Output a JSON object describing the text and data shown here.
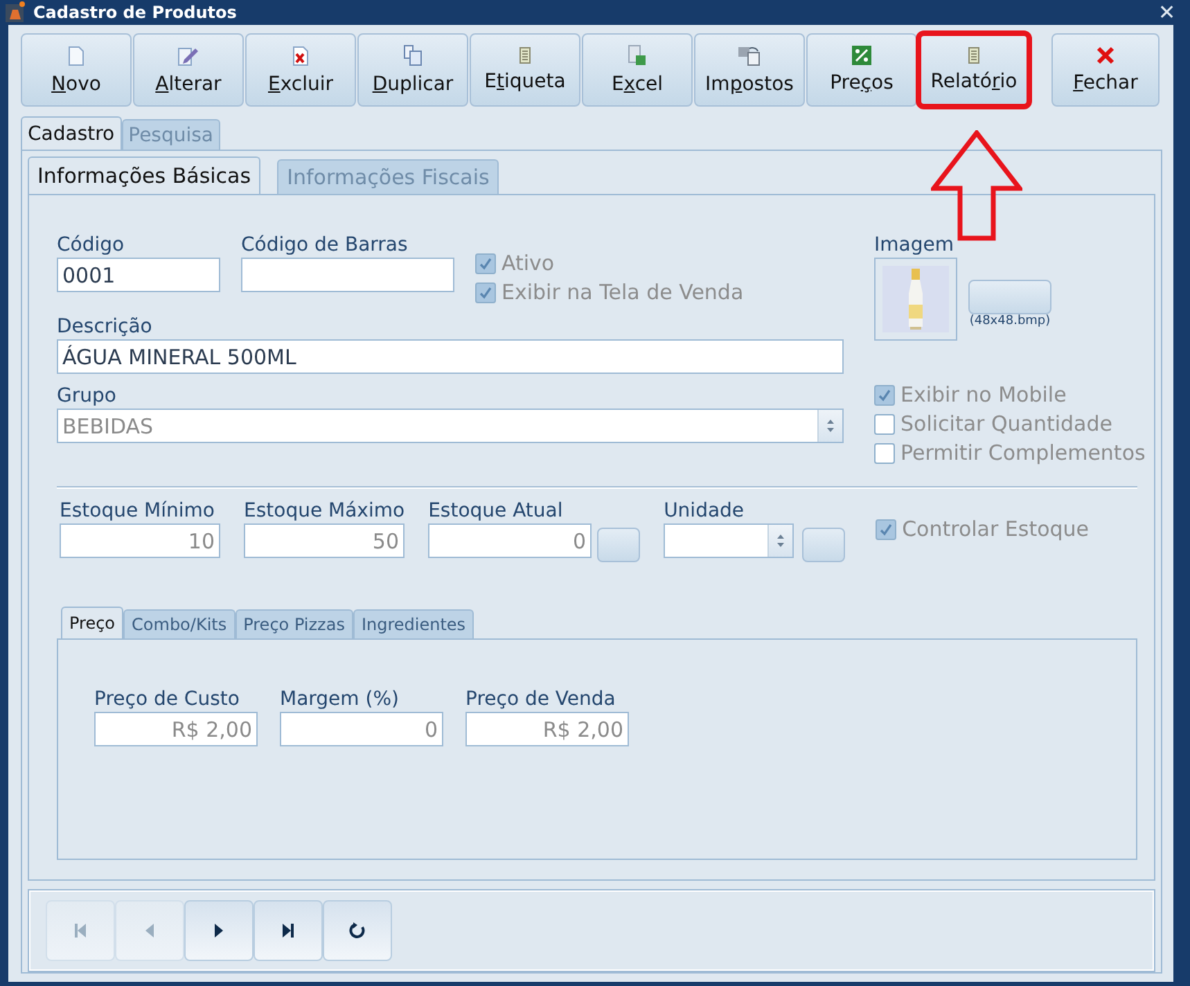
{
  "window": {
    "title": "Cadastro de Produtos",
    "close": "✕"
  },
  "toolbar": [
    {
      "key": "N",
      "post": "ovo",
      "highlighted": false
    },
    {
      "key": "A",
      "post": "lterar",
      "highlighted": false
    },
    {
      "key": "E",
      "post": "xcluir",
      "highlighted": false
    },
    {
      "key": "D",
      "post": "uplicar",
      "highlighted": false
    },
    {
      "pre": "E",
      "key": "t",
      "post": "iqueta",
      "highlighted": false
    },
    {
      "pre": "E",
      "key": "x",
      "post": "cel",
      "highlighted": false
    },
    {
      "pre": "Im",
      "key": "p",
      "post": "ostos",
      "highlighted": false
    },
    {
      "pre": "Pre",
      "key": "ç",
      "post": "os",
      "highlighted": false
    },
    {
      "pre": "Relató",
      "key": "r",
      "post": "io",
      "highlighted": true
    },
    {
      "key": "F",
      "post": "echar",
      "highlighted": false
    }
  ],
  "tabs": [
    {
      "label": "Cadastro",
      "selected": true
    },
    {
      "label": "Pesquisa",
      "selected": false
    }
  ],
  "subtabs": [
    {
      "label": "Informações Básicas",
      "selected": true
    },
    {
      "label": "Informações Fiscais",
      "selected": false
    }
  ],
  "form": {
    "codigo": {
      "label": "Código",
      "value": "0001"
    },
    "barras": {
      "label": "Código de Barras"
    },
    "flags": [
      {
        "label": "Ativo",
        "checked": true,
        "disabled": true
      },
      {
        "label": "Exibir na Tela de Venda",
        "checked": true,
        "disabled": true
      }
    ],
    "descricao": {
      "label": "Descrição",
      "value": "ÁGUA MINERAL 500ML"
    },
    "grupo": {
      "label": "Grupo",
      "value": "BEBIDAS"
    },
    "imagem": {
      "label": "Imagem",
      "hint": "(48x48.bmp)"
    },
    "options": [
      {
        "label": "Exibir no Mobile",
        "checked": true,
        "disabled": true
      },
      {
        "label": "Solicitar Quantidade",
        "checked": false,
        "disabled": true
      },
      {
        "label": "Permitir Complementos",
        "checked": false,
        "disabled": true
      }
    ],
    "estoque": [
      {
        "label": "Estoque Mínimo",
        "value": "10",
        "kind": "number"
      },
      {
        "label": "Estoque Máximo",
        "value": "50",
        "kind": "number"
      },
      {
        "label": "Estoque Atual",
        "value": "0",
        "kind": "number-button"
      },
      {
        "label": "Unidade",
        "kind": "select-button"
      }
    ],
    "controlar": {
      "label": "Controlar Estoque",
      "checked": true,
      "disabled": true
    }
  },
  "price_tabs": [
    {
      "label": "Preço",
      "selected": true
    },
    {
      "label": "Combo/Kits",
      "selected": false
    },
    {
      "label": "Preço Pizzas",
      "selected": false
    },
    {
      "label": "Ingredientes",
      "selected": false
    }
  ],
  "prices": [
    {
      "label": "Preço de Custo",
      "value": "R$ 2,00"
    },
    {
      "label": "Margem (%)",
      "value": "0"
    },
    {
      "label": "Preço de Venda",
      "value": "R$ 2,00"
    }
  ],
  "navigator": [
    {
      "disabled": true
    },
    {
      "disabled": true
    },
    {
      "disabled": false
    },
    {
      "disabled": false
    },
    {
      "disabled": false
    }
  ]
}
